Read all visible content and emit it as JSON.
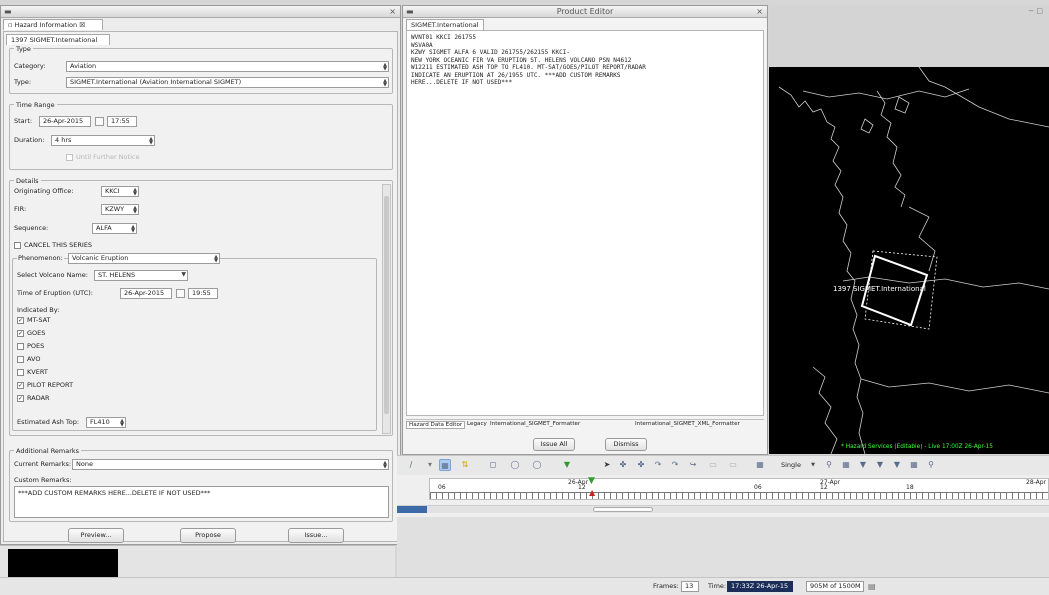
{
  "hazard_panel": {
    "view_title": "Hazard Information",
    "view_tab_suffix": "☒",
    "hazard_tab": "1397 SIGMET.International",
    "type_group": "Type",
    "category_label": "Category:",
    "category_value": "Aviation",
    "type_label": "Type:",
    "type_value": "SIGMET.International (Aviation International SIGMET)",
    "time_range_group": "Time Range",
    "start_label": "Start:",
    "start_date": "26-Apr-2015",
    "start_time": "17:55",
    "duration_label": "Duration:",
    "duration_value": "4 hrs",
    "until_further_notice": "Until Further Notice",
    "details_group": "Details",
    "originating_office_label": "Originating Office:",
    "originating_office_value": "KKCI",
    "fir_label": "FIR:",
    "fir_value": "KZWY",
    "sequence_label": "Sequence:",
    "sequence_value": "ALFA",
    "cancel_series_label": "CANCEL THIS SERIES",
    "phenomenon_label": "Phenomenon:",
    "phenomenon_value": "Volcanic Eruption",
    "volcano_label": "Select Volcano Name:",
    "volcano_value": "ST. HELENS",
    "eruption_time_label": "Time of Eruption (UTC):",
    "eruption_date": "26-Apr-2015",
    "eruption_time": "19:55",
    "indicated_by_label": "Indicated By:",
    "indicators": [
      {
        "label": "MT-SAT",
        "checked": "✓"
      },
      {
        "label": "GOES",
        "checked": "✓"
      },
      {
        "label": "POES",
        "checked": ""
      },
      {
        "label": "AVO",
        "checked": ""
      },
      {
        "label": "KVERT",
        "checked": ""
      },
      {
        "label": "PILOT REPORT",
        "checked": "✓"
      },
      {
        "label": "RADAR",
        "checked": "✓"
      }
    ],
    "ash_top_label": "Estimated Ash Top:",
    "ash_top_value": "FL410",
    "additional_remarks_group": "Additional Remarks",
    "current_remarks_label": "Current Remarks:",
    "current_remarks_value": "None",
    "custom_remarks_label": "Custom Remarks:",
    "custom_remarks_value": "***ADD CUSTOM REMARKS HERE...DELETE IF NOT USED***",
    "preview_button": "Preview...",
    "propose_button": "Propose",
    "issue_button": "Issue..."
  },
  "product_editor": {
    "title": "Product Editor",
    "text_tab": "SIGMET.International",
    "product_lines": [
      "WVNT01 KKCI 261755",
      "WSVA0A",
      "KZWY SIGMET ALFA 6 VALID 261755/262155 KKCI-",
      "NEW YORK OCEANIC FIR VA ERUPTION ST. HELENS VOLCANO PSN N4612",
      "W12211 ESTIMATED ASH TOP TO FL410. MT-SAT/GOES/PILOT REPORT/RADAR",
      "INDICATE AN ERUPTION AT 26/1955 UTC. ***ADD CUSTOM REMARKS",
      "HERE...DELETE IF NOT USED***"
    ],
    "bottom_tabs": [
      "Hazard Data Editor",
      "Legacy",
      "International_SIGMET_Formatter",
      "International_SIGMET_XML_Formatter"
    ],
    "issue_all_button": "Issue All",
    "dismiss_button": "Dismiss"
  },
  "map": {
    "hazard_label": "1397 SIGMET.International",
    "status_text": "* Hazard Services (Editable) - Live 17:00Z 26-Apr-15",
    "background_color": "#000000",
    "coast_color": "#cfcfcf",
    "polygon_color": "#ffffff"
  },
  "toolbar": {
    "single_label": "Single",
    "timeline_dates": [
      "26-Apr",
      "27-Apr",
      "28-Apr"
    ],
    "timeline_hours": [
      "06",
      "12",
      "06",
      "12",
      "18"
    ]
  },
  "statusbar": {
    "frames_label": "Frames:",
    "frames_value": "13",
    "time_label": "Time:",
    "time_value": "17:33Z 26-Apr-15",
    "memory_value": "905M of 1500M"
  },
  "colors": {
    "accent": "#3d6aa8",
    "map_status": "#3cff3c"
  }
}
